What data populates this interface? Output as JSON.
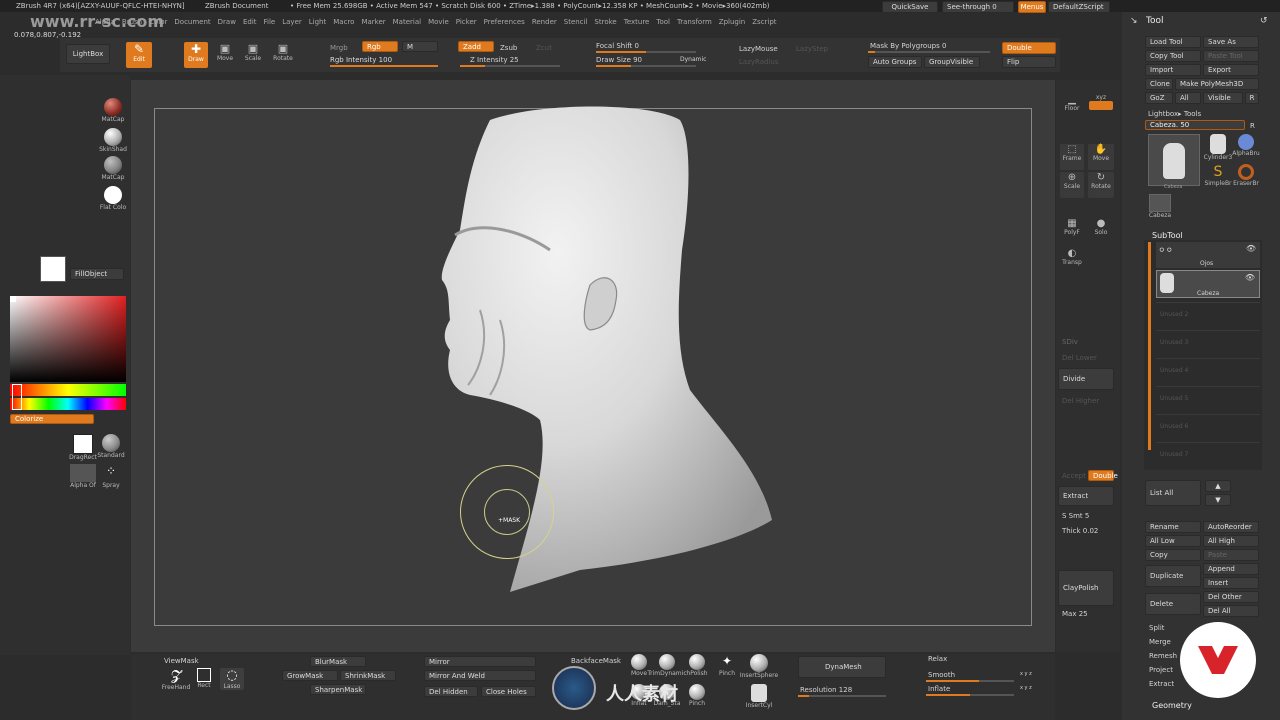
{
  "watermark": "www.rr-sc.com",
  "title": {
    "app": "ZBrush 4R7 (x64)[AZXY-AUUF-QFLC-HTEI-NHYN]",
    "doc": "ZBrush Document",
    "stats": "• Free Mem 25.698GB • Active Mem 547 • Scratch Disk 600 • ZTime▸1.388 • PolyCount▸12.358 KP • MeshCount▸2 • Movie▸360(402mb)"
  },
  "coords": "0.078,0.807,-0.192",
  "menus": [
    "Alpha",
    "Brush",
    "Color",
    "Document",
    "Draw",
    "Edit",
    "File",
    "Layer",
    "Light",
    "Macro",
    "Marker",
    "Material",
    "Movie",
    "Picker",
    "Preferences",
    "Render",
    "Stencil",
    "Stroke",
    "Texture",
    "Tool",
    "Transform",
    "Zplugin",
    "Zscript"
  ],
  "topright": {
    "quicksave": "QuickSave",
    "seethrough": "See-through  0",
    "menus": "Menus",
    "script": "DefaultZScript"
  },
  "toolbar": {
    "lightbox": "LightBox",
    "edit": "Edit",
    "draw": "Draw",
    "move": "Move",
    "scale": "Scale",
    "rotate": "Rotate",
    "mrgb": "Mrgb",
    "rgb": "Rgb",
    "m": "M",
    "rgb_intensity": "Rgb Intensity 100",
    "zadd": "Zadd",
    "zsub": "Zsub",
    "zcut": "Zcut",
    "z_intensity": "Z Intensity 25",
    "focal_shift": "Focal Shift 0",
    "draw_size": "Draw Size 90",
    "dynamic": "Dynamic",
    "lazymouse": "LazyMouse",
    "lazystep": "LazyStep",
    "lazyradius": "LazyRadius",
    "mask_polygroups": "Mask By Polygroups 0",
    "auto_groups": "Auto Groups",
    "group_visible": "GroupVisible",
    "double": "Double",
    "flip": "Flip"
  },
  "leftshelf": {
    "matcap_red": "MatCap",
    "skinshade": "SkinShad",
    "matcap_gray": "MatCap",
    "flat_color": "Flat Colo",
    "fillobject": "FillObject",
    "colorize": "Colorize",
    "dragrect": "DragRect",
    "standard": "Standard",
    "alpha_off": "Alpha Of",
    "spray": "Spray"
  },
  "rightshelf": {
    "floor": "Floor",
    "xyz": "xyz",
    "frame": "Frame",
    "move": "Move",
    "scale": "Scale",
    "rotate": "Rotate",
    "polyf": "PolyF",
    "solo": "Solo",
    "transp": "Transp",
    "sdiv": "SDiv",
    "del_lower": "Del Lower",
    "divide": "Divide",
    "del_higher": "Del Higher",
    "accept": "Accept",
    "double": "Double",
    "extract": "Extract",
    "smt": "S Smt 5",
    "thick": "Thick 0.02",
    "claypolish": "ClayPolish",
    "max": "Max 25"
  },
  "cursor": {
    "label": "+MASK"
  },
  "tool": {
    "title": "Tool",
    "load": "Load Tool",
    "save_as": "Save As",
    "copy_tool": "Copy Tool",
    "paste_tool": "Paste Tool",
    "import": "Import",
    "export": "Export",
    "clone": "Clone",
    "make_polymesh": "Make PolyMesh3D",
    "goz": "GoZ",
    "all": "All",
    "visible": "Visible",
    "r": "R",
    "lightbox_tools": "Lightbox▸ Tools",
    "current": "Cabeza. 50",
    "thumbs": [
      "Cabeza",
      "Cylinder3",
      "AlphaBru",
      "SimpleBr",
      "EraserBr",
      "Cabeza"
    ],
    "subtool_title": "SubTool",
    "subtools": [
      "Ojos",
      "Cabeza"
    ],
    "unused": [
      "Unused 2",
      "Unused 3",
      "Unused 4",
      "Unused 5",
      "Unused 6",
      "Unused 7"
    ],
    "list_all": "List All",
    "rename": "Rename",
    "autoreorder": "AutoReorder",
    "all_low": "All Low",
    "all_high": "All High",
    "copy": "Copy",
    "paste": "Paste",
    "append": "Append",
    "duplicate": "Duplicate",
    "insert": "Insert",
    "del_other": "Del Other",
    "delete": "Delete",
    "del_all": "Del All",
    "split": "Split",
    "merge": "Merge",
    "remesh": "Remesh",
    "project": "Project",
    "extract": "Extract",
    "geometry": "Geometry"
  },
  "bottom": {
    "viewmask": "ViewMask",
    "freehand": "FreeHand",
    "rect": "Rect",
    "lasso": "Lasso",
    "blurmask": "BlurMask",
    "growmask": "GrowMask",
    "shrinkmask": "ShrinkMask",
    "sharpenmask": "SharpenMask",
    "mirror": "Mirror",
    "mirror_weld": "Mirror And Weld",
    "del_hidden": "Del Hidden",
    "close_holes": "Close Holes",
    "backfacemask": "BackfaceMask",
    "brushes": [
      "Move",
      "TrimDynamic",
      "hPolish",
      "Pinch",
      "InsertSphere",
      "Inflat",
      "Dam_Sta",
      "Pinch",
      "",
      "InsertCyl"
    ],
    "dynamesh": "DynaMesh",
    "resolution": "Resolution 128",
    "relax": "Relax",
    "smooth": "Smooth",
    "inflate": "Inflate",
    "xyz": "x y z"
  },
  "logo_caption": "人人素材"
}
